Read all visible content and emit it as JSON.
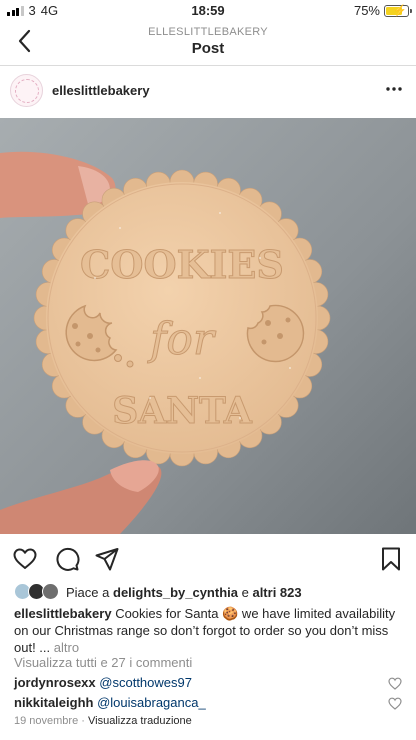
{
  "status_bar": {
    "carrier": "3",
    "network": "4G",
    "time": "18:59",
    "battery_percent": "75%",
    "battery_level": 0.75
  },
  "nav": {
    "account": "ELLESLITTLEBAKERY",
    "title": "Post"
  },
  "post": {
    "username": "elleslittlebakery",
    "image_text": {
      "line1": "COOKIES",
      "line2": "for",
      "line3": "SANTA"
    },
    "likes": {
      "prefix": "Piace a",
      "liker": "delights_by_cynthia",
      "joiner": "e",
      "others": "altri 823"
    },
    "caption": {
      "author": "elleslittlebakery",
      "text": "Cookies for Santa 🍪 we have limited availability on our Christmas range so don’t forgot to order so you don’t miss out! ...",
      "more": "altro"
    },
    "view_all_comments": "Visualizza tutti e 27 i commenti",
    "comments": [
      {
        "user": "jordynrosexx",
        "mention": "@scotthowes97"
      },
      {
        "user": "nikkitaleighh",
        "mention": "@louisabraganca_"
      }
    ],
    "date": "19 novembre",
    "separator": "·",
    "translate": "Visualizza traduzione"
  },
  "colors": {
    "text": "#262626",
    "secondary": "#8e8e8e",
    "mention": "#00376b",
    "cookie": "#e9c49e",
    "background_photo": "#8e9498"
  },
  "icons": [
    "back-chevron-icon",
    "more-options-icon",
    "heart-icon",
    "comment-icon",
    "share-icon",
    "bookmark-icon"
  ]
}
